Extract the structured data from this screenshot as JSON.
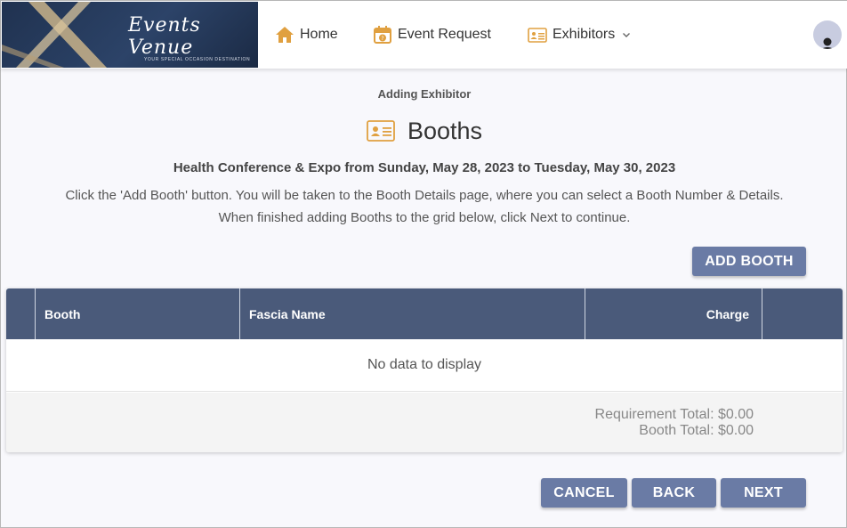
{
  "header": {
    "logo": {
      "script_text": "Events Venue",
      "tagline": "YOUR SPECIAL OCCASION DESTINATION"
    },
    "nav": {
      "home": {
        "label": "Home",
        "icon": "home-icon"
      },
      "event_request": {
        "label": "Event Request",
        "icon": "calendar-question-icon"
      },
      "exhibitors": {
        "label": "Exhibitors",
        "icon": "id-card-icon"
      }
    },
    "user_icon": "user-avatar-icon"
  },
  "page": {
    "subtitle": "Adding Exhibitor",
    "title": "Booths",
    "event_line": "Health Conference & Expo from Sunday, May 28, 2023 to Tuesday, May 30, 2023",
    "instruction_1": "Click the 'Add Booth' button. You will be taken to the Booth Details page, where you can select a Booth Number & Details.",
    "instruction_2": "When finished adding Booths to the grid below, click Next to continue."
  },
  "actions": {
    "add_booth": "ADD BOOTH",
    "cancel": "CANCEL",
    "back": "BACK",
    "next": "NEXT"
  },
  "grid": {
    "columns": [
      "",
      "Booth",
      "Fascia Name",
      "Charge",
      ""
    ],
    "empty_text": "No data to display",
    "requirement_total": "Requirement Total: $0.00",
    "booth_total": "Booth Total: $0.00"
  },
  "colors": {
    "accent_icon": "#e0a040",
    "grid_header": "#4a5a7a",
    "button": "#6a7ba5"
  }
}
